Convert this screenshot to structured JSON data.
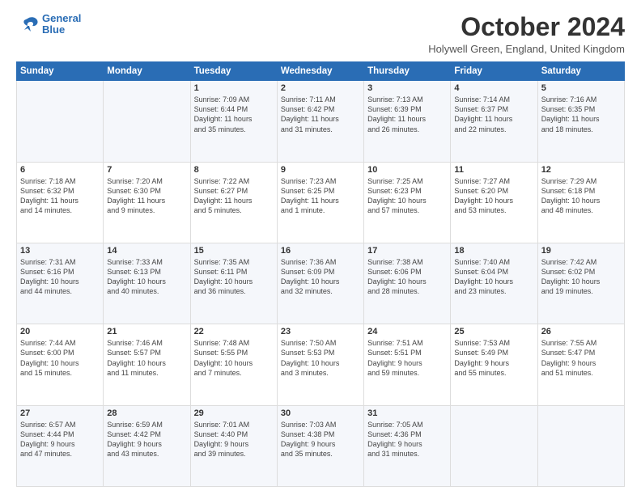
{
  "logo": {
    "line1": "General",
    "line2": "Blue"
  },
  "header": {
    "title": "October 2024",
    "location": "Holywell Green, England, United Kingdom"
  },
  "weekdays": [
    "Sunday",
    "Monday",
    "Tuesday",
    "Wednesday",
    "Thursday",
    "Friday",
    "Saturday"
  ],
  "weeks": [
    [
      {
        "day": "",
        "info": ""
      },
      {
        "day": "",
        "info": ""
      },
      {
        "day": "1",
        "info": "Sunrise: 7:09 AM\nSunset: 6:44 PM\nDaylight: 11 hours\nand 35 minutes."
      },
      {
        "day": "2",
        "info": "Sunrise: 7:11 AM\nSunset: 6:42 PM\nDaylight: 11 hours\nand 31 minutes."
      },
      {
        "day": "3",
        "info": "Sunrise: 7:13 AM\nSunset: 6:39 PM\nDaylight: 11 hours\nand 26 minutes."
      },
      {
        "day": "4",
        "info": "Sunrise: 7:14 AM\nSunset: 6:37 PM\nDaylight: 11 hours\nand 22 minutes."
      },
      {
        "day": "5",
        "info": "Sunrise: 7:16 AM\nSunset: 6:35 PM\nDaylight: 11 hours\nand 18 minutes."
      }
    ],
    [
      {
        "day": "6",
        "info": "Sunrise: 7:18 AM\nSunset: 6:32 PM\nDaylight: 11 hours\nand 14 minutes."
      },
      {
        "day": "7",
        "info": "Sunrise: 7:20 AM\nSunset: 6:30 PM\nDaylight: 11 hours\nand 9 minutes."
      },
      {
        "day": "8",
        "info": "Sunrise: 7:22 AM\nSunset: 6:27 PM\nDaylight: 11 hours\nand 5 minutes."
      },
      {
        "day": "9",
        "info": "Sunrise: 7:23 AM\nSunset: 6:25 PM\nDaylight: 11 hours\nand 1 minute."
      },
      {
        "day": "10",
        "info": "Sunrise: 7:25 AM\nSunset: 6:23 PM\nDaylight: 10 hours\nand 57 minutes."
      },
      {
        "day": "11",
        "info": "Sunrise: 7:27 AM\nSunset: 6:20 PM\nDaylight: 10 hours\nand 53 minutes."
      },
      {
        "day": "12",
        "info": "Sunrise: 7:29 AM\nSunset: 6:18 PM\nDaylight: 10 hours\nand 48 minutes."
      }
    ],
    [
      {
        "day": "13",
        "info": "Sunrise: 7:31 AM\nSunset: 6:16 PM\nDaylight: 10 hours\nand 44 minutes."
      },
      {
        "day": "14",
        "info": "Sunrise: 7:33 AM\nSunset: 6:13 PM\nDaylight: 10 hours\nand 40 minutes."
      },
      {
        "day": "15",
        "info": "Sunrise: 7:35 AM\nSunset: 6:11 PM\nDaylight: 10 hours\nand 36 minutes."
      },
      {
        "day": "16",
        "info": "Sunrise: 7:36 AM\nSunset: 6:09 PM\nDaylight: 10 hours\nand 32 minutes."
      },
      {
        "day": "17",
        "info": "Sunrise: 7:38 AM\nSunset: 6:06 PM\nDaylight: 10 hours\nand 28 minutes."
      },
      {
        "day": "18",
        "info": "Sunrise: 7:40 AM\nSunset: 6:04 PM\nDaylight: 10 hours\nand 23 minutes."
      },
      {
        "day": "19",
        "info": "Sunrise: 7:42 AM\nSunset: 6:02 PM\nDaylight: 10 hours\nand 19 minutes."
      }
    ],
    [
      {
        "day": "20",
        "info": "Sunrise: 7:44 AM\nSunset: 6:00 PM\nDaylight: 10 hours\nand 15 minutes."
      },
      {
        "day": "21",
        "info": "Sunrise: 7:46 AM\nSunset: 5:57 PM\nDaylight: 10 hours\nand 11 minutes."
      },
      {
        "day": "22",
        "info": "Sunrise: 7:48 AM\nSunset: 5:55 PM\nDaylight: 10 hours\nand 7 minutes."
      },
      {
        "day": "23",
        "info": "Sunrise: 7:50 AM\nSunset: 5:53 PM\nDaylight: 10 hours\nand 3 minutes."
      },
      {
        "day": "24",
        "info": "Sunrise: 7:51 AM\nSunset: 5:51 PM\nDaylight: 9 hours\nand 59 minutes."
      },
      {
        "day": "25",
        "info": "Sunrise: 7:53 AM\nSunset: 5:49 PM\nDaylight: 9 hours\nand 55 minutes."
      },
      {
        "day": "26",
        "info": "Sunrise: 7:55 AM\nSunset: 5:47 PM\nDaylight: 9 hours\nand 51 minutes."
      }
    ],
    [
      {
        "day": "27",
        "info": "Sunrise: 6:57 AM\nSunset: 4:44 PM\nDaylight: 9 hours\nand 47 minutes."
      },
      {
        "day": "28",
        "info": "Sunrise: 6:59 AM\nSunset: 4:42 PM\nDaylight: 9 hours\nand 43 minutes."
      },
      {
        "day": "29",
        "info": "Sunrise: 7:01 AM\nSunset: 4:40 PM\nDaylight: 9 hours\nand 39 minutes."
      },
      {
        "day": "30",
        "info": "Sunrise: 7:03 AM\nSunset: 4:38 PM\nDaylight: 9 hours\nand 35 minutes."
      },
      {
        "day": "31",
        "info": "Sunrise: 7:05 AM\nSunset: 4:36 PM\nDaylight: 9 hours\nand 31 minutes."
      },
      {
        "day": "",
        "info": ""
      },
      {
        "day": "",
        "info": ""
      }
    ]
  ]
}
